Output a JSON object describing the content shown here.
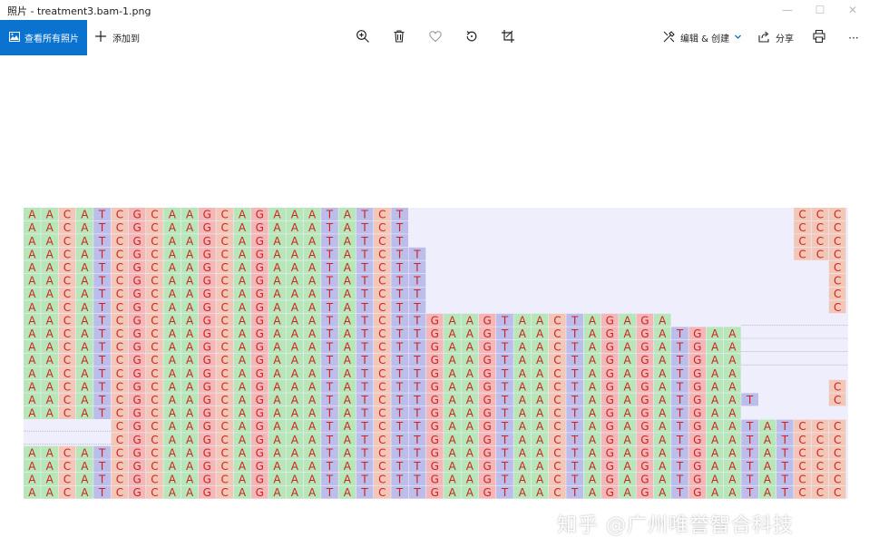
{
  "window": {
    "title": "照片 - treatment3.bam-1.png",
    "minimize": "—",
    "maximize": "☐",
    "close": "✕"
  },
  "toolbar": {
    "view_all_label": "查看所有照片",
    "add_label": "添加到",
    "edit_create_label": "编辑 & 创建",
    "share_label": "分享",
    "more_label": "···"
  },
  "image": {
    "colors": {
      "A": "#b7e6b9",
      "C": "#f3c7b7",
      "G": "#f4b7b7",
      "T": "#bcbdea",
      "letter": "#cc2222",
      "background": "#eeeefc"
    },
    "sequence": "AACATCGCAAGCAGAAATATCTTGAAGTAACTAGAGATGAATATCCC"
  },
  "watermark": "知乎 @广州唯誉智合科技"
}
